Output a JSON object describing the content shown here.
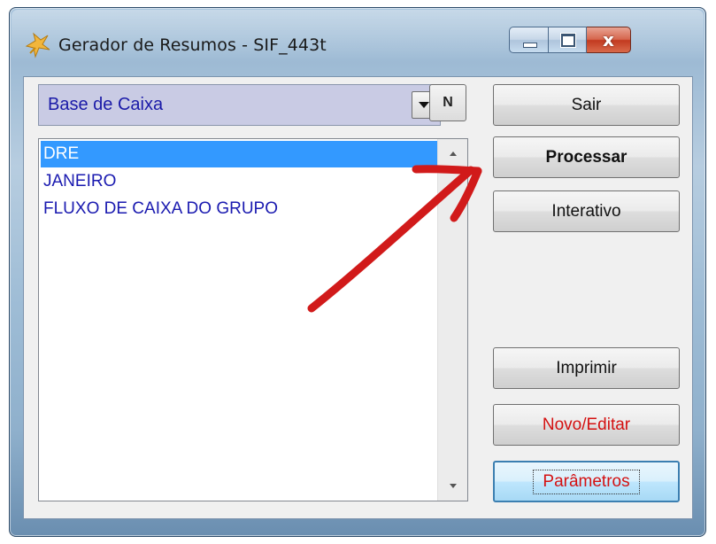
{
  "window": {
    "title": "Gerador de Resumos - SIF_443t",
    "caption_buttons": [
      "minimize",
      "maximize",
      "close"
    ],
    "close_glyph": "x"
  },
  "combo": {
    "value": "Base de Caixa"
  },
  "n_button": {
    "label": "N"
  },
  "list": {
    "items": [
      {
        "label": "DRE",
        "selected": true
      },
      {
        "label": "JANEIRO",
        "selected": false
      },
      {
        "label": "FLUXO DE CAIXA DO GRUPO",
        "selected": false
      }
    ]
  },
  "buttons": {
    "sair": "Sair",
    "processar": "Processar",
    "interativo": "Interativo",
    "imprimir": "Imprimir",
    "novo_editar": "Novo/Editar",
    "parametros": "Parâmetros"
  },
  "colors": {
    "list_text": "#1a1ab0",
    "selection": "#3399ff",
    "red_label": "#d41111",
    "annotation_arrow": "#d11a1a"
  },
  "icons": [
    "app-logo-icon",
    "minimize-icon",
    "maximize-icon",
    "close-icon",
    "dropdown-arrow-icon",
    "scroll-up-icon",
    "scroll-down-icon"
  ]
}
